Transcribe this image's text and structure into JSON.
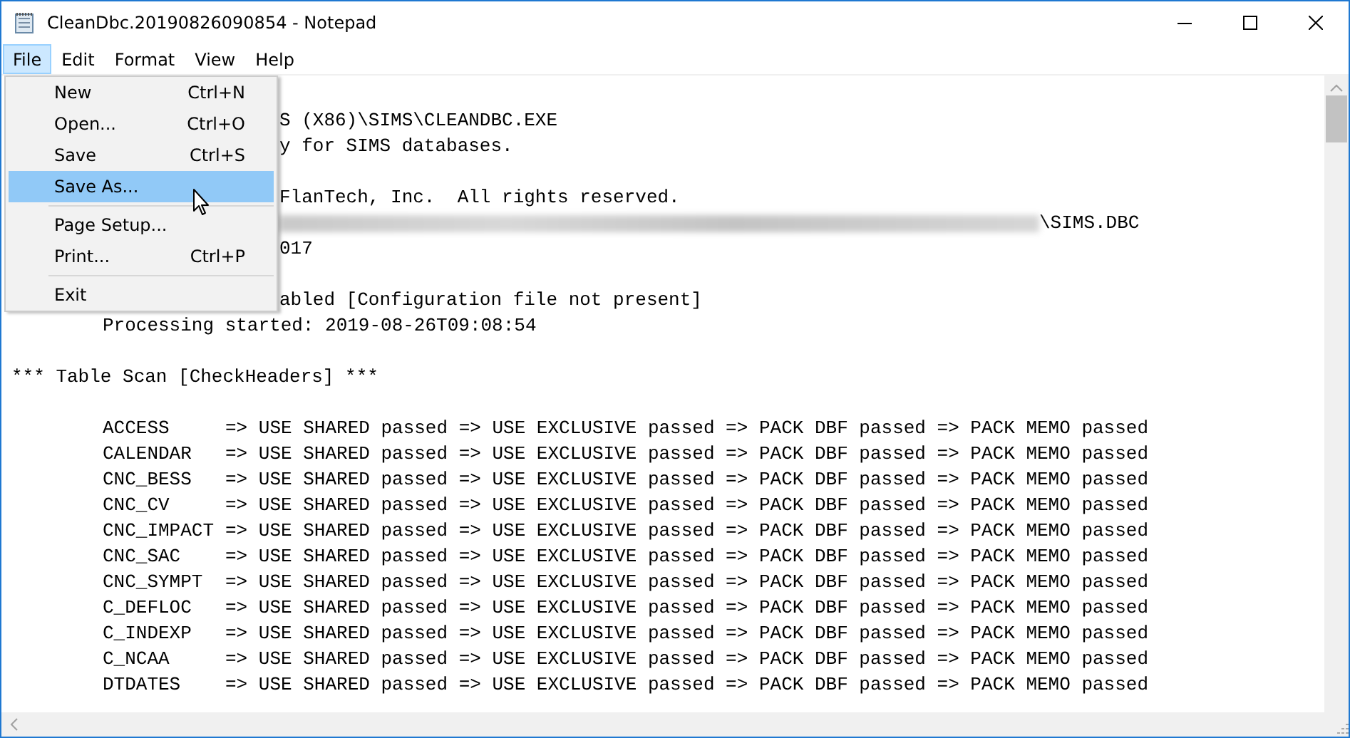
{
  "window": {
    "title": "CleanDbc.20190826090854 - Notepad"
  },
  "menu_bar": [
    {
      "label": "File",
      "selected": true
    },
    {
      "label": "Edit",
      "selected": false
    },
    {
      "label": "Format",
      "selected": false
    },
    {
      "label": "View",
      "selected": false
    },
    {
      "label": "Help",
      "selected": false
    }
  ],
  "file_menu": [
    {
      "kind": "item",
      "label": "New",
      "shortcut": "Ctrl+N",
      "selected": false
    },
    {
      "kind": "item",
      "label": "Open...",
      "shortcut": "Ctrl+O",
      "selected": false
    },
    {
      "kind": "item",
      "label": "Save",
      "shortcut": "Ctrl+S",
      "selected": false
    },
    {
      "kind": "item",
      "label": "Save As...",
      "selected": true
    },
    {
      "kind": "separator"
    },
    {
      "kind": "item",
      "label": "Page Setup...",
      "selected": false
    },
    {
      "kind": "item",
      "label": "Print...",
      "shortcut": "Ctrl+P",
      "selected": false
    },
    {
      "kind": "separator"
    },
    {
      "kind": "item",
      "label": "Exit",
      "selected": false
    }
  ],
  "document": {
    "lines": [
      {
        "kind": "blank"
      },
      {
        "kind": "covered",
        "text": "S (X86)\\SIMS\\CLEANDBC.EXE"
      },
      {
        "kind": "covered",
        "text": "y for SIMS databases."
      },
      {
        "kind": "blank"
      },
      {
        "kind": "covered",
        "text": "FlanTech, Inc.  All rights reserved."
      },
      {
        "kind": "redacted",
        "text": "\\SIMS.DBC"
      },
      {
        "kind": "covered",
        "text": "017"
      },
      {
        "kind": "blank"
      },
      {
        "kind": "covered",
        "text": "abled [Configuration file not present]"
      },
      {
        "kind": "indented",
        "text": "Processing started: 2019-08-26T09:08:54"
      },
      {
        "kind": "blank"
      },
      {
        "kind": "text",
        "text": "*** Table Scan [CheckHeaders] ***"
      },
      {
        "kind": "blank"
      }
    ],
    "scan_rows": [
      {
        "table": "ACCESS",
        "result": "=> USE SHARED passed => USE EXCLUSIVE passed => PACK DBF passed => PACK MEMO passed"
      },
      {
        "table": "CALENDAR",
        "result": "=> USE SHARED passed => USE EXCLUSIVE passed => PACK DBF passed => PACK MEMO passed"
      },
      {
        "table": "CNC_BESS",
        "result": "=> USE SHARED passed => USE EXCLUSIVE passed => PACK DBF passed => PACK MEMO passed"
      },
      {
        "table": "CNC_CV",
        "result": "=> USE SHARED passed => USE EXCLUSIVE passed => PACK DBF passed => PACK MEMO passed"
      },
      {
        "table": "CNC_IMPACT",
        "result": "=> USE SHARED passed => USE EXCLUSIVE passed => PACK DBF passed => PACK MEMO passed"
      },
      {
        "table": "CNC_SAC",
        "result": "=> USE SHARED passed => USE EXCLUSIVE passed => PACK DBF passed => PACK MEMO passed"
      },
      {
        "table": "CNC_SYMPT",
        "result": "=> USE SHARED passed => USE EXCLUSIVE passed => PACK DBF passed => PACK MEMO passed"
      },
      {
        "table": "C_DEFLOC",
        "result": "=> USE SHARED passed => USE EXCLUSIVE passed => PACK DBF passed => PACK MEMO passed"
      },
      {
        "table": "C_INDEXP",
        "result": "=> USE SHARED passed => USE EXCLUSIVE passed => PACK DBF passed => PACK MEMO passed"
      },
      {
        "table": "C_NCAA",
        "result": "=> USE SHARED passed => USE EXCLUSIVE passed => PACK DBF passed => PACK MEMO passed"
      },
      {
        "table": "DTDATES",
        "result": "=> USE SHARED passed => USE EXCLUSIVE passed => PACK DBF passed => PACK MEMO passed"
      }
    ]
  }
}
